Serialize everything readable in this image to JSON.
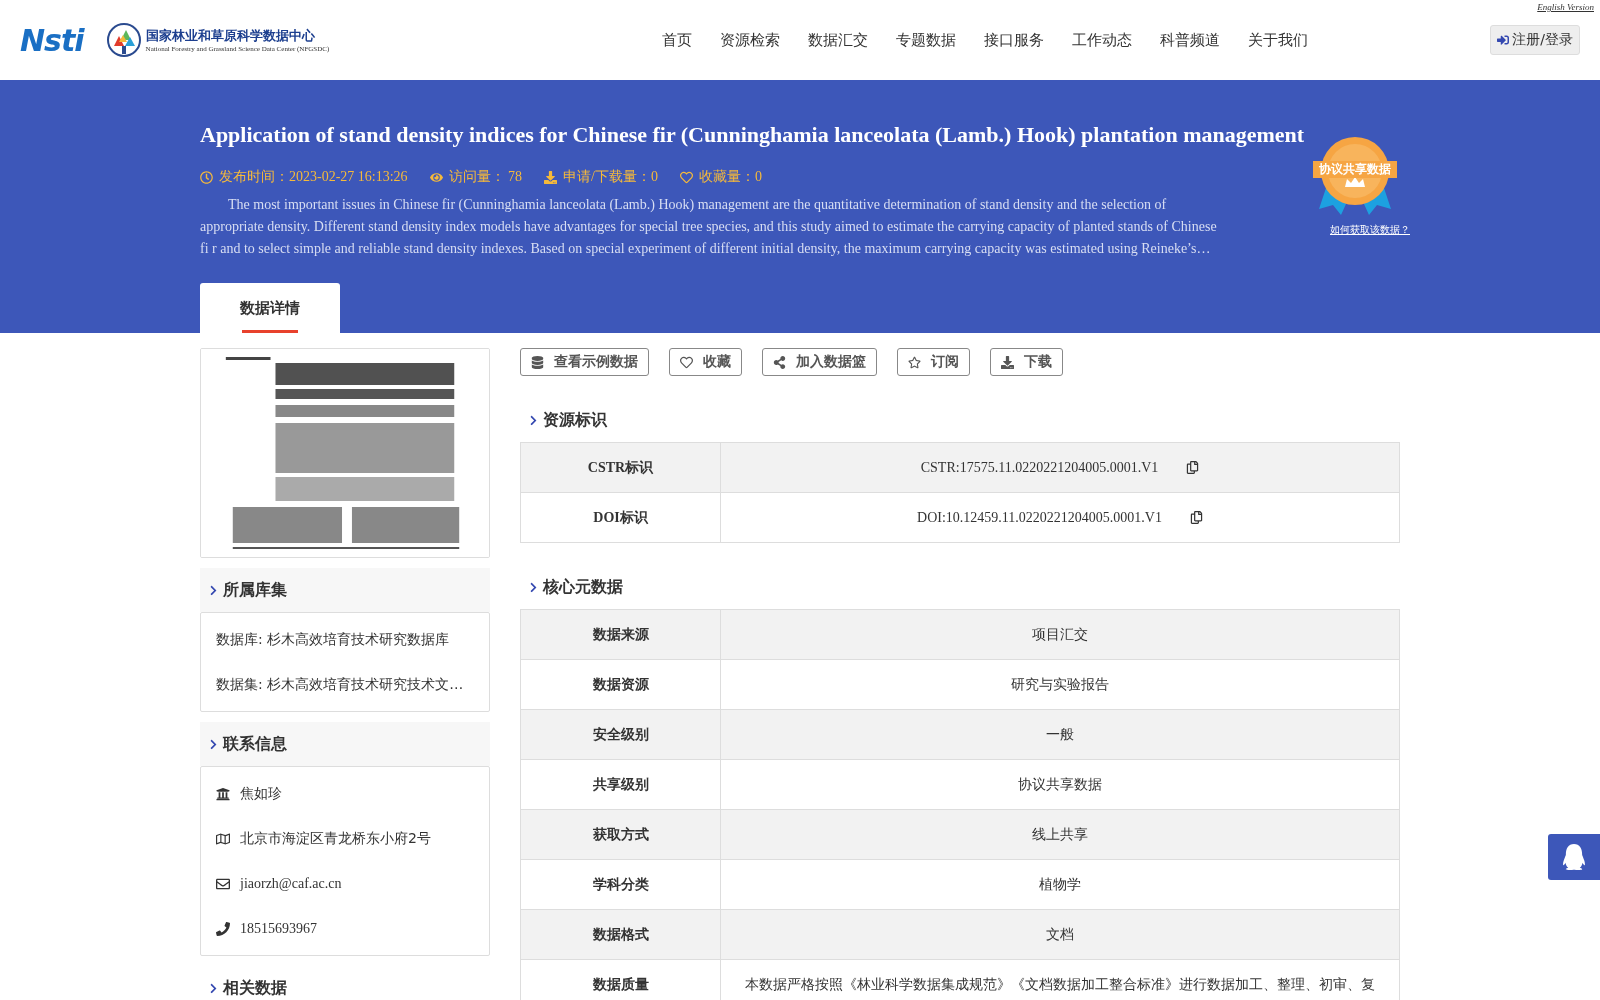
{
  "header": {
    "logo_text": "Nsti",
    "org_name": "国家林业和草原科学数据中心",
    "org_name_en": "National Forestry and Grassland Science Data Center (NFGSDC)",
    "english_link": "English Version",
    "nav": [
      "首页",
      "资源检索",
      "数据汇交",
      "专题数据",
      "接口服务",
      "工作动态",
      "科普频道",
      "关于我们"
    ],
    "login_button": "注册/登录"
  },
  "hero": {
    "title": "Application of stand density indices for Chinese fir (Cunninghamia lanceolata (Lamb.) Hook) plantation management",
    "meta": [
      {
        "kind": "time",
        "text": "发布时间：2023-02-27 16:13:26"
      },
      {
        "kind": "views",
        "text": "访问量： 78"
      },
      {
        "kind": "downloads",
        "text": "申请/下载量：0"
      },
      {
        "kind": "favorites",
        "text": "收藏量：0"
      }
    ],
    "abstract": "The most important issues in Chinese fir (Cunninghamia lanceolata (Lamb.) Hook) management are the quantitative determination of stand density and the selection of appropriate density. Different stand density index models have advantages for special tree species, and this study aimed to estimate the carrying capacity of planted stands of Chinese fi r and to select simple and reliable stand density indexes. Based on special experiment of different initial density, the maximum carrying capacity was estimated using Reineke’s…",
    "badge": {
      "label": "协议共享数据",
      "link": "如何获取该数据？"
    },
    "tabs": [
      {
        "label": "数据详情",
        "selected": true
      }
    ]
  },
  "sidebar": {
    "collections": {
      "title": "所属库集",
      "items": [
        "数据库: 杉木高效培育技术研究数据库",
        "数据集: 杉木高效培育技术研究技术文…"
      ]
    },
    "contact": {
      "title": "联系信息",
      "items": [
        {
          "kind": "org",
          "text": "焦如珍"
        },
        {
          "kind": "address",
          "text": "北京市海淀区青龙桥东小府2号"
        },
        {
          "kind": "email",
          "text": "jiaorzh@caf.ac.cn"
        },
        {
          "kind": "phone",
          "text": "18515693967"
        }
      ]
    },
    "related": {
      "title": "相关数据"
    }
  },
  "actions": [
    {
      "kind": "sample",
      "label": "查看示例数据"
    },
    {
      "kind": "favorite",
      "label": "收藏"
    },
    {
      "kind": "basket",
      "label": "加入数据篮"
    },
    {
      "kind": "subscribe",
      "label": "订阅"
    },
    {
      "kind": "download",
      "label": "下载"
    }
  ],
  "identifiers": {
    "title": "资源标识",
    "rows": [
      {
        "label": "CSTR标识",
        "value": "CSTR:17575.11.0220221204005.0001.V1"
      },
      {
        "label": "DOI标识",
        "value": "DOI:10.12459.11.0220221204005.0001.V1"
      }
    ]
  },
  "core": {
    "title": "核心元数据",
    "rows": [
      {
        "label": "数据来源",
        "value": "项目汇交"
      },
      {
        "label": "数据资源",
        "value": "研究与实验报告"
      },
      {
        "label": "安全级别",
        "value": "一般"
      },
      {
        "label": "共享级别",
        "value": "协议共享数据"
      },
      {
        "label": "获取方式",
        "value": "线上共享"
      },
      {
        "label": "学科分类",
        "value": "植物学"
      },
      {
        "label": "数据格式",
        "value": "文档"
      },
      {
        "label": "数据质量",
        "value": "本数据严格按照《林业科学数据集成规范》《文档数据加工整合标准》进行数据加工、整理、初审、复"
      }
    ]
  }
}
